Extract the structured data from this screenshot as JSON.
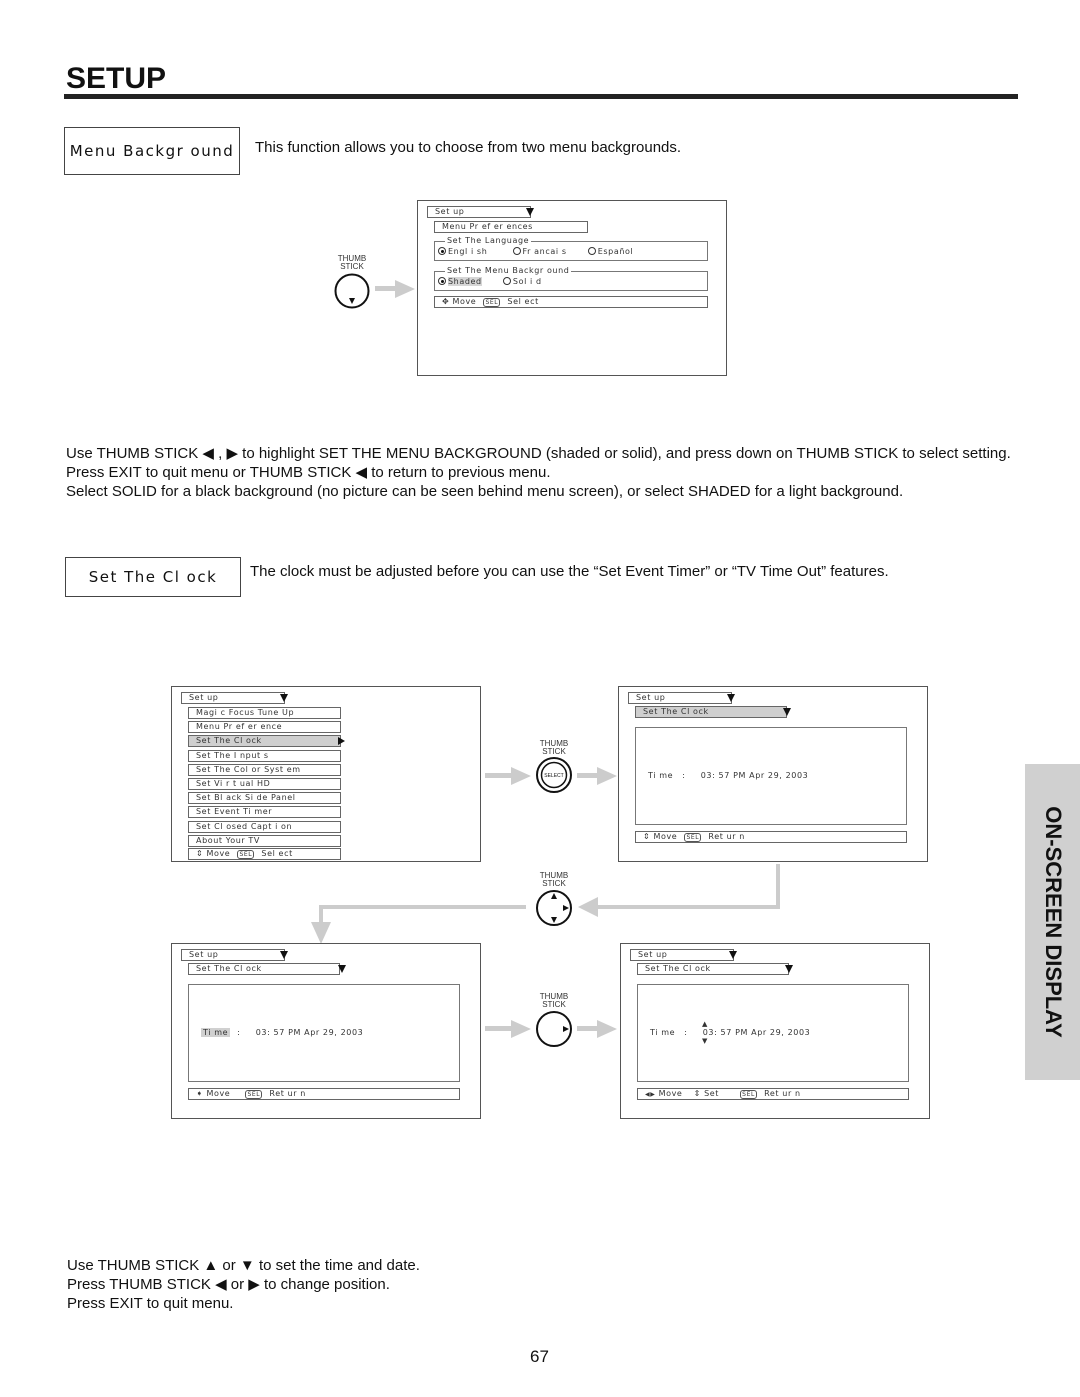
{
  "header": {
    "title": "SETUP"
  },
  "menu_background": {
    "label": "Menu Backgr ound",
    "description": "This function allows you to choose from two menu backgrounds.",
    "screen": {
      "setup_label": "Set up",
      "submenu_label": "Menu Pr ef er ences",
      "language_group": "Set The Language",
      "language_options": [
        {
          "label": "Engl i sh",
          "selected": true
        },
        {
          "label": "Fr ancai s",
          "selected": false
        },
        {
          "label": "Español",
          "selected": false
        }
      ],
      "background_group": "Set The Menu Backgr ound",
      "background_options": [
        {
          "label": "Shaded",
          "selected": true
        },
        {
          "label": "Sol i d",
          "selected": false
        }
      ],
      "footer_move": "Move",
      "footer_sel": "SEL",
      "footer_action": "Sel ect"
    },
    "thumbstick_label_1": "THUMB",
    "thumbstick_label_2": "STICK",
    "instructions": [
      "Use THUMB STICK ◀ , ▶ to highlight SET THE MENU BACKGROUND (shaded or solid), and press down on THUMB STICK to select setting.",
      "Press EXIT to quit menu or THUMB STICK ◀ to return to previous menu.",
      "Select SOLID for a black background (no picture can be seen behind menu screen), or select SHADED for a light background."
    ]
  },
  "set_clock": {
    "label": "Set The Cl ock",
    "description": "The clock must be adjusted before you can use the “Set Event Timer” or “TV Time Out” features.",
    "main_menu": {
      "setup_label": "Set up",
      "items": [
        {
          "label": "Magi c Focus Tune Up",
          "highlighted": false
        },
        {
          "label": "Menu Pr ef er ence",
          "highlighted": false
        },
        {
          "label": "Set The Cl ock",
          "highlighted": true
        },
        {
          "label": "Set The I nput s",
          "highlighted": false
        },
        {
          "label": "Set The Col or Syst em",
          "highlighted": false
        },
        {
          "label": "Set Vi r t ual HD",
          "highlighted": false
        },
        {
          "label": "Set Bl ack Si de Panel",
          "highlighted": false
        },
        {
          "label": "Set Event Ti mer",
          "highlighted": false
        },
        {
          "label": "Set Cl osed Capt i on",
          "highlighted": false
        },
        {
          "label": "About Your TV",
          "highlighted": false
        }
      ],
      "footer_move": "Move",
      "footer_sel": "SEL",
      "footer_action": "Sel ect"
    },
    "clock_screen": {
      "setup_label": "Set up",
      "submenu_label": "Set The Cl ock",
      "time_label": "Ti me",
      "time_value": "03: 57 PM Apr 29, 2003",
      "footer_move": "Move",
      "footer_set": "Set",
      "footer_sel": "SEL",
      "footer_action": "Ret ur n"
    },
    "thumbstick_label_1": "THUMB",
    "thumbstick_label_2": "STICK",
    "select_label": "SELECT",
    "instructions": [
      "Use THUMB STICK ▲ or ▼ to set the time and date.",
      "Press THUMB STICK ◀ or ▶ to change position.",
      "Press EXIT to quit menu."
    ]
  },
  "side_tab": {
    "label": "ON-SCREEN DISPLAY"
  },
  "page_number": "67"
}
